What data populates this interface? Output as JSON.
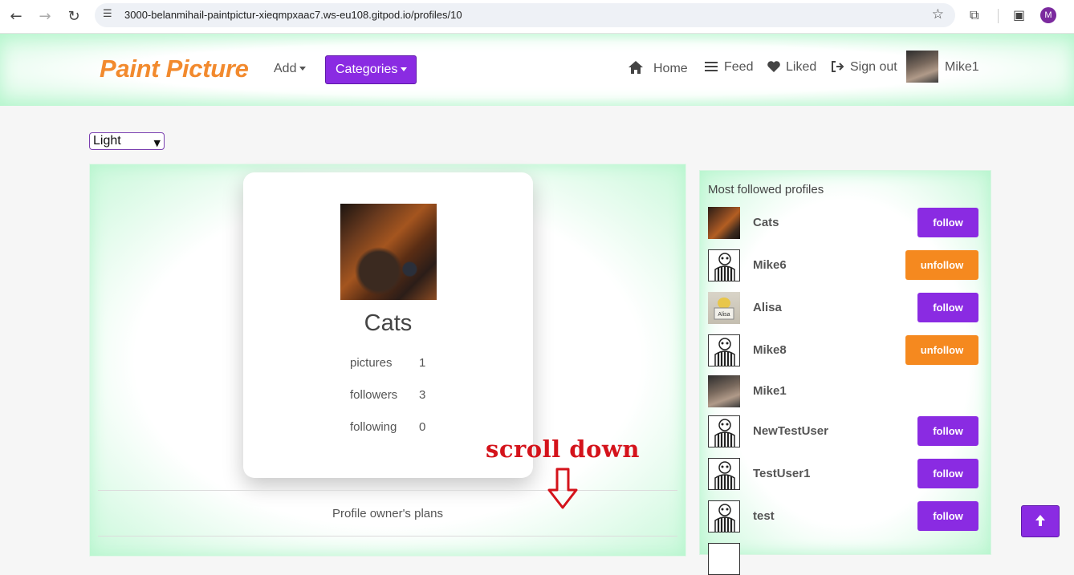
{
  "browser": {
    "url": "3000-belanmihail-paintpictur-xieqmpxaac7.ws-eu108.gitpod.io/profiles/10",
    "profile_initial": "M",
    "icons": [
      "back-icon",
      "forward-icon",
      "reload-icon",
      "site-settings-icon",
      "star-icon",
      "extensions-icon",
      "side-panel-icon"
    ]
  },
  "navbar": {
    "brand": "Paint Picture",
    "add_label": "Add",
    "categories_label": "Categories",
    "home_label": "Home",
    "feed_label": "Feed",
    "liked_label": "Liked",
    "signout_label": "Sign out",
    "username": "Mike1"
  },
  "theme": {
    "selected": "Light"
  },
  "profile": {
    "name": "Cats",
    "stats": [
      {
        "label": "pictures",
        "value": "1"
      },
      {
        "label": "followers",
        "value": "3"
      },
      {
        "label": "following",
        "value": "0"
      }
    ],
    "plans_label": "Profile owner's plans",
    "annotation": "scroll down"
  },
  "sidebar": {
    "title": "Most followed profiles",
    "profiles": [
      {
        "name": "Cats",
        "action": "follow"
      },
      {
        "name": "Mike6",
        "action": "unfollow"
      },
      {
        "name": "Alisa",
        "action": "follow"
      },
      {
        "name": "Mike8",
        "action": "unfollow"
      },
      {
        "name": "Mike1",
        "action": ""
      },
      {
        "name": "NewTestUser",
        "action": "follow"
      },
      {
        "name": "TestUser1",
        "action": "follow"
      },
      {
        "name": "test",
        "action": "follow"
      }
    ]
  },
  "colors": {
    "accent": "#8a2be2",
    "brand": "#f28a2e",
    "unfollow": "#f5891f",
    "annotation": "#d4131b"
  }
}
